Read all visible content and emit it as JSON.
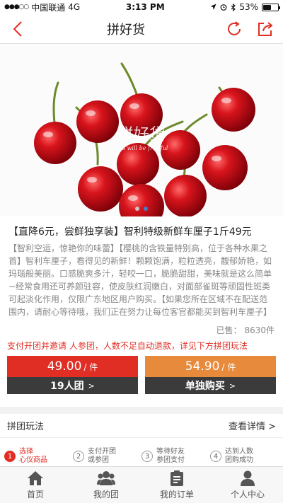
{
  "status": {
    "carrier": "中国联通",
    "network": "4G",
    "time": "3:13 PM",
    "battery": "53%",
    "battery_level": 0.53
  },
  "nav": {
    "title": "拼好货",
    "icons": [
      "back-icon",
      "refresh-icon",
      "share-icon"
    ]
  },
  "colors": {
    "brand_red": "#e02e24",
    "orange": "#e78a3b",
    "dark": "#3b3b3b"
  },
  "hero": {
    "watermark": "拼好货",
    "watermark_sub": "you will be fruitful",
    "slide_count": 2,
    "active_slide": 1
  },
  "product": {
    "title": "【直降6元，尝鲜独享装】智利特级新鲜车厘子1斤49元",
    "description": "【智利空运，惊艳你的味蕾】【樱桃的含铁量特别高，位于各种水果之首】智利车厘子，看得见的新鲜！颗颗饱满，粒粒透亮，馥郁娇艳，如玛瑙般美丽。口感脆爽多汁，轻咬一口，脆脆甜甜，美味就是这么简单~经常食用还可养颜驻容，使皮肤红润嫩白，对面部雀斑等顽固性斑类可起淡化作用，仅限广东地区用户购买。【如果您所在区域不在配送范围内，请耐心等待哦，我们正在努力让每位客官都能买到智利车厘子】",
    "sold_label": "已售：",
    "sold_count": "8630件",
    "rule_notice": "支付开团并邀请   人参团，人数不足自动退款，详见下方拼团玩法"
  },
  "buy": {
    "group": {
      "price": "49.00",
      "unit": "/ 件",
      "label": "19人团",
      "arrow": ">"
    },
    "single": {
      "price": "54.90",
      "unit": "/ 件",
      "label": "单独购买",
      "arrow": ">"
    }
  },
  "rules": {
    "title": "拼团玩法",
    "more": "查看详情 >",
    "steps": [
      {
        "num": "1",
        "line1": "选择",
        "line2": "心仪商品"
      },
      {
        "num": "2",
        "line1": "支付开团",
        "line2": "或参团"
      },
      {
        "num": "3",
        "line1": "等待好友",
        "line2": "参团支付"
      },
      {
        "num": "4",
        "line1": "达到人数",
        "line2": "团购成功"
      }
    ]
  },
  "tabbar": [
    {
      "label": "首页",
      "icon": "home-icon"
    },
    {
      "label": "我的团",
      "icon": "group-icon"
    },
    {
      "label": "我的订单",
      "icon": "order-icon"
    },
    {
      "label": "个人中心",
      "icon": "person-icon"
    }
  ]
}
